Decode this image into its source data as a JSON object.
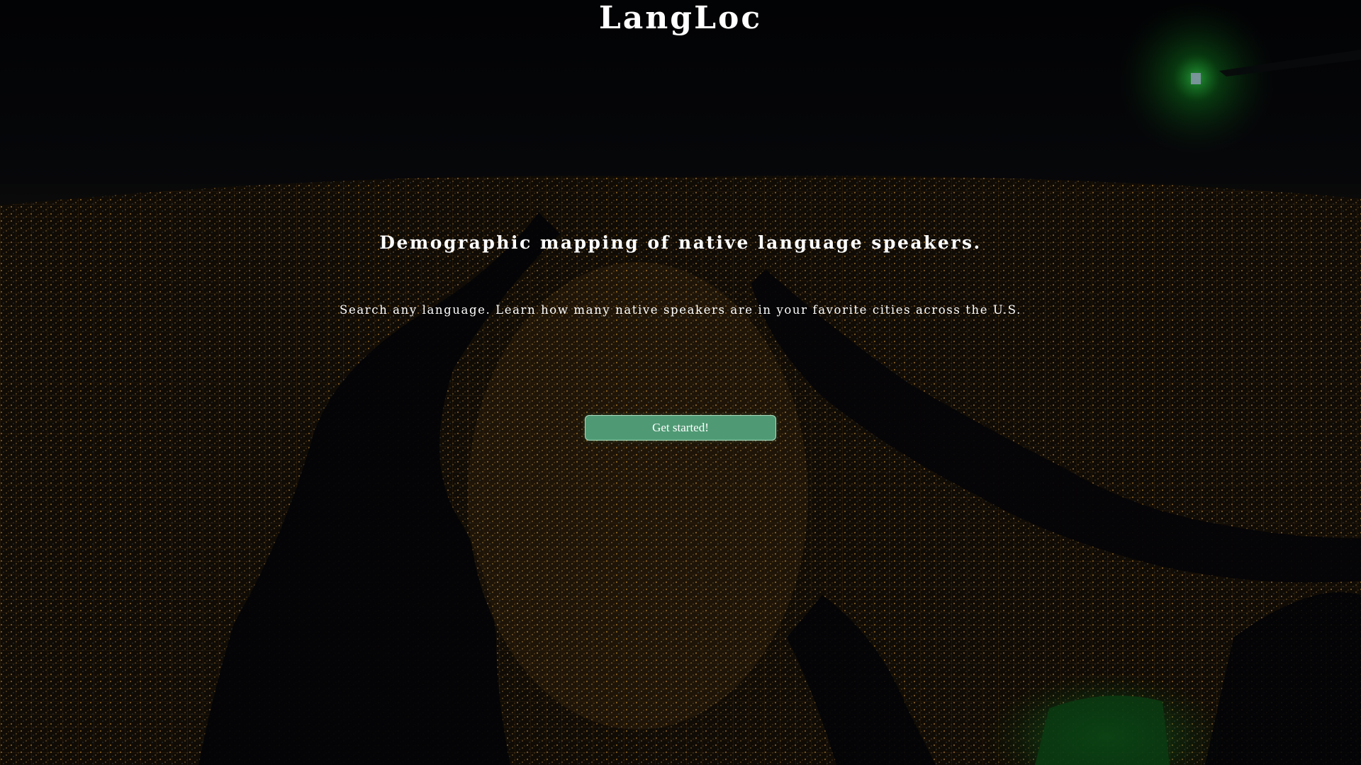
{
  "app": {
    "title": "LangLoc"
  },
  "hero": {
    "tagline": "Demographic mapping of native language speakers.",
    "subtitle": "Search any language. Learn how many native speakers are in your favorite cities across the U.S.",
    "cta_label": "Get started!"
  },
  "colors": {
    "accent": "#4f9a74",
    "text": "#ffffff",
    "background": "#05070c"
  }
}
